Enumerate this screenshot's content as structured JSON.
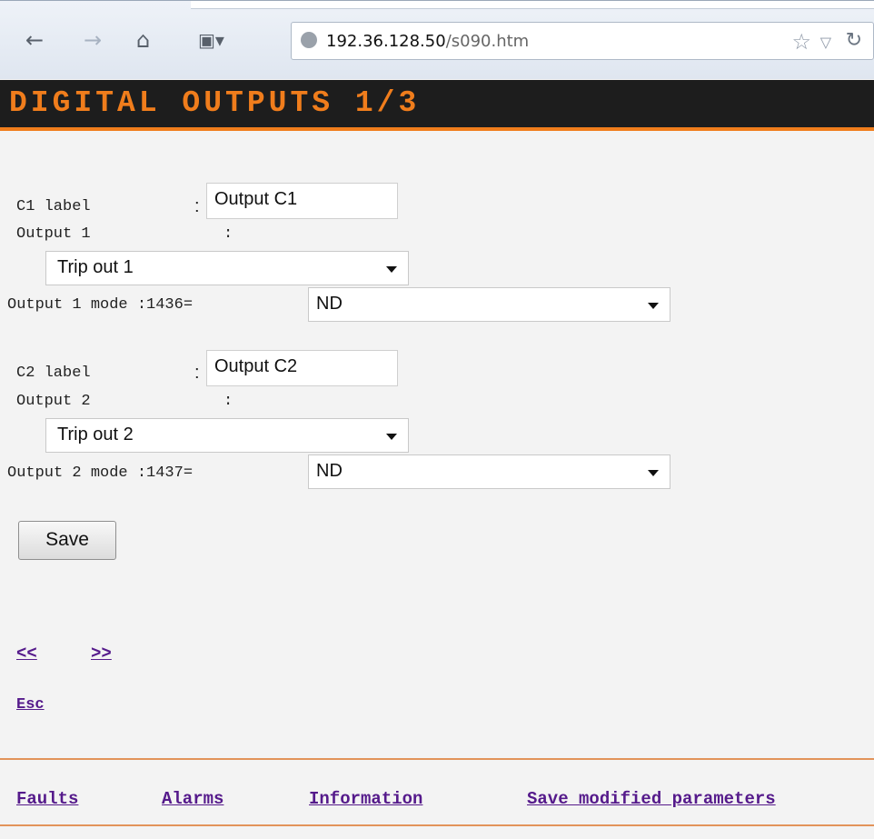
{
  "browser": {
    "url_host": "192.36.128.50",
    "url_path": "/s090.htm"
  },
  "page": {
    "title": "DIGITAL OUTPUTS 1/3"
  },
  "outputs": [
    {
      "label_caption": "C1 label",
      "label_sep": ":",
      "label_value": "Output C1",
      "output_caption": "Output 1",
      "output_sep": ":",
      "output_value": "Trip out 1",
      "mode_caption": "Output 1 mode :1436=",
      "mode_value": "ND"
    },
    {
      "label_caption": "C2 label",
      "label_sep": ":",
      "label_value": "Output C2",
      "output_caption": "Output 2",
      "output_sep": ":",
      "output_value": "Trip out 2",
      "mode_caption": "Output 2 mode :1437=",
      "mode_value": "ND"
    }
  ],
  "save_label": "Save",
  "pager": {
    "prev": "<<",
    "next": ">>"
  },
  "esc": "Esc",
  "footer": {
    "faults": "Faults",
    "alarms": "Alarms",
    "information": "Information",
    "save_modified": "Save modified parameters"
  },
  "colors": {
    "accent": "#f07d1c",
    "header_bg": "#1d1d1d",
    "link": "#551a8b"
  },
  "icons": [
    "back-arrow-icon",
    "forward-arrow-icon",
    "home-icon",
    "bookmark-icon",
    "globe-icon",
    "star-icon",
    "dropdown-icon",
    "reload-icon"
  ]
}
